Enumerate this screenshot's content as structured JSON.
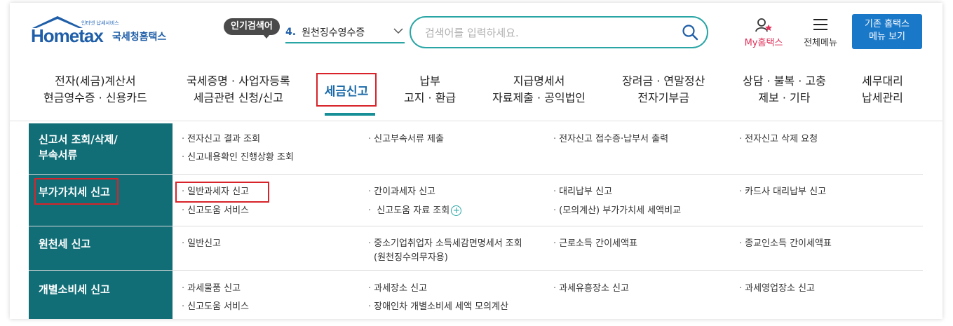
{
  "header": {
    "logo_small_text": "인터넷 납세서비스",
    "logo_word": "Hometax",
    "logo_kr": "국세청홈택스",
    "popular_badge": "인기검색어",
    "popular_rank": "4.",
    "popular_term": "원천징수영수증",
    "search_placeholder": "검색어를 입력하세요.",
    "my_hometax": "My홈택스",
    "all_menu": "전체메뉴",
    "legacy_line1": "기존 홈택스",
    "legacy_line2": "메뉴 보기"
  },
  "nav": {
    "items": [
      {
        "line1": "전자(세금)계산서",
        "line2": "현금영수증 · 신용카드"
      },
      {
        "line1": "국세증명 · 사업자등록",
        "line2": "세금관련 신청/신고"
      },
      {
        "line1": "세금신고",
        "line2": ""
      },
      {
        "line1": "납부",
        "line2": "고지 · 환급"
      },
      {
        "line1": "지급명세서",
        "line2": "자료제출 · 공익법인"
      },
      {
        "line1": "장려금 · 연말정산",
        "line2": "전자기부금"
      },
      {
        "line1": "상담 · 불복 · 고충",
        "line2": "제보 · 기타"
      },
      {
        "line1": "세무대리",
        "line2": "납세관리"
      }
    ],
    "active": "세금신고"
  },
  "sections": [
    {
      "title_line1": "신고서 조회/삭제/",
      "title_line2": "부속서류",
      "links": [
        "전자신고 결과 조회",
        "신고부속서류 제출",
        "전자신고 접수증·납부서 출력",
        "전자신고 삭제 요청",
        "신고내용확인 진행상황 조회"
      ]
    },
    {
      "title_line1": "부가가치세 신고",
      "links": [
        "일반과세자 신고",
        "간이과세자 신고",
        "대리납부 신고",
        "카드사 대리납부 신고",
        "신고도움 서비스",
        "신고도움 자료 조회",
        "(모의계산) 부가가치세 세액비교"
      ]
    },
    {
      "title_line1": "원천세 신고",
      "links": [
        "일반신고",
        "중소기업취업자 소득세감면명세서 조회",
        "(원천징수의무자용)",
        "근로소득 간이세액표",
        "종교인소득 간이세액표"
      ]
    },
    {
      "title_line1": "개별소비세 신고",
      "links": [
        "과세물품 신고",
        "과세장소 신고",
        "과세유흥장소 신고",
        "과세영업장소 신고",
        "신고도움 서비스",
        "장애인차 개별소비세 세액 모의계산"
      ]
    }
  ],
  "colors": {
    "accent_teal": "#116e77",
    "highlight_red": "#d8232a",
    "brand_blue": "#1f5ea8",
    "my_pink": "#e0315a"
  }
}
